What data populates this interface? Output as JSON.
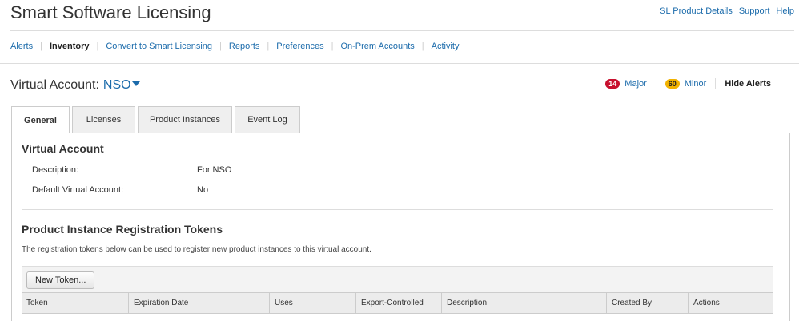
{
  "app": {
    "title": "Smart Software Licensing"
  },
  "top_links": [
    "SL Product Details",
    "Support",
    "Help"
  ],
  "nav": {
    "items": [
      "Alerts",
      "Inventory",
      "Convert to Smart Licensing",
      "Reports",
      "Preferences",
      "On-Prem Accounts",
      "Activity"
    ],
    "active": "Inventory"
  },
  "virtual_account": {
    "label": "Virtual Account:",
    "name": "NSO"
  },
  "alerts": {
    "major": {
      "count": "14",
      "label": "Major",
      "color": "#c8102e"
    },
    "minor": {
      "count": "60",
      "label": "Minor",
      "color": "#f2b200"
    },
    "hide_label": "Hide Alerts"
  },
  "tabs": [
    "General",
    "Licenses",
    "Product Instances",
    "Event Log"
  ],
  "active_tab": "General",
  "general": {
    "title": "Virtual Account",
    "fields": [
      {
        "label": "Description:",
        "value": "For NSO"
      },
      {
        "label": "Default Virtual Account:",
        "value": "No"
      }
    ]
  },
  "tokens": {
    "title": "Product Instance Registration Tokens",
    "description": "The registration tokens below can be used to register new product instances to this virtual account.",
    "new_button": "New Token...",
    "columns": [
      "Token",
      "Expiration Date",
      "Uses",
      "Export-Controlled",
      "Description",
      "Created By",
      "Actions"
    ]
  },
  "colors": {
    "link": "#1b6bab"
  }
}
